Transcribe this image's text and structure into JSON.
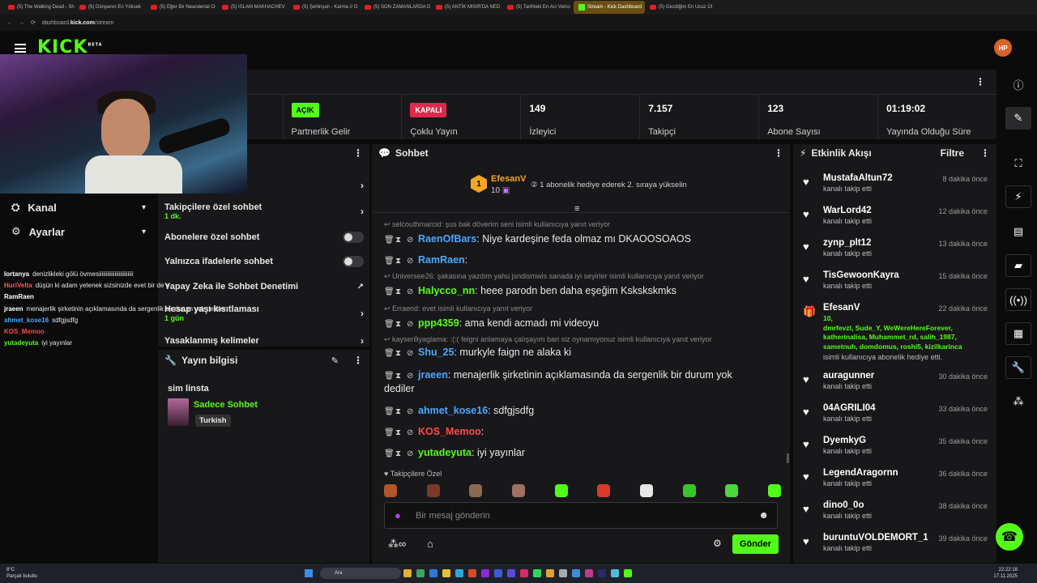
{
  "browser": {
    "tabs": [
      "(5) The Walking Dead - Sh",
      "(5) Dünyanın En Yüksek",
      "(5) Eğer Bir Neandertal O",
      "(5) ISLAM MAKHACHEV",
      "(5) Şehinşah - Karma // O",
      "(5) SON ZAMANLARDA D",
      "(5) ANTİK MISIR'DA NED",
      "(5) Tarihteki En Acı Verici",
      "Stream - Kick Dashboard",
      "(5) Gezdiğim En Ucuz Ül"
    ],
    "url_host": "dashboard.",
    "url_bold": "kick.com",
    "url_path": "/stream"
  },
  "kick": {
    "logo": "KICK",
    "beta": "BETA",
    "avatar": "HP"
  },
  "leftnav": {
    "kanal": "Kanal",
    "ayarlar": "Ayarlar"
  },
  "overlay_chat": [
    {
      "user": "lortanya",
      "color": "#ffffff",
      "msg": "denizlikleki gölü övmesiiiiiiiiiiiiiiiiiiiiiiii"
    },
    {
      "user": "HuriVelta",
      "color": "#ff5b5b",
      "msg": "düşün ki adam yetenek sizsinizde evet bir de o"
    },
    {
      "user": "RamRaen",
      "color": "#ffffff",
      "msg": ""
    },
    {
      "user": "jraeen",
      "color": "#ffffff",
      "msg": "menajerlik şirketinin açıklamasında da sergenlik bir durum yok dediler"
    },
    {
      "user": "ahmet_kose16",
      "color": "#4aa8ff",
      "msg": "sdfgjsdfg"
    },
    {
      "user": "KOS_Memoo",
      "color": "#ff4a4a",
      "msg": ""
    },
    {
      "user": "yutadeyuta",
      "color": "#53fc18",
      "msg": "iyi yayınlar"
    }
  ],
  "stats": {
    "partnerlik": {
      "badge": "AÇIK",
      "label": "Partnerlik Gelir"
    },
    "coklu": {
      "badge": "KAPALI",
      "label": "Çoklu Yayın"
    },
    "izleyici": {
      "value": "149",
      "label": "İzleyici"
    },
    "takipci": {
      "value": "7.157",
      "label": "Takipçi"
    },
    "abone": {
      "value": "123",
      "label": "Abone Sayısı"
    },
    "sure": {
      "value": "01:19:02",
      "label": "Yayında Olduğu Süre"
    }
  },
  "settings": {
    "takipci_only": "Takipçilere özel sohbet",
    "takipci_sub": "1 dk.",
    "abone_only": "Abonelere özel sohbet",
    "ifade_only": "Yalnızca ifadelerle sohbet",
    "ai": "Yapay Zeka ile Sohbet Denetimi",
    "hesap": "Hesap yaşı kısıtlaması",
    "hesap_sub": "1 gün",
    "yasak": "Yasaklanmış kelimeler"
  },
  "yayin": {
    "title": "Yayın bilgisi",
    "stream_title": "sim linsta",
    "category": "Sadece Sohbet",
    "tag": "Turkish"
  },
  "chat": {
    "title": "Sohbet",
    "pinned_user": "EfesanV",
    "pinned_count": "10",
    "pinned_note": "1 abonelik hediye ederek 2. sıraya yükselin",
    "messages": [
      {
        "reply": "selcouthmarcid: şus bak döverim seni isimli kullanıcıya yanıt veriyor"
      },
      {
        "user": "RaenOfBars",
        "color": "#4aa8ff",
        "text": "Niye kardeşine feda olmaz mı DKAOOSOAOS"
      },
      {
        "user": "RamRaen",
        "color": "#4aa8ff",
        "text": ""
      },
      {
        "reply": "Universee26: şakasına yazdım yahu jsndismwis sanada iyi seyirler isimli kullanıcıya yanıt veriyor"
      },
      {
        "user": "Halycco_nn",
        "color": "#53fc18",
        "text": "heee parodn ben daha eşeğim Kskskskmks"
      },
      {
        "reply": "Erraend: evet isimli kullanıcıya yanıt veriyor"
      },
      {
        "user": "ppp4359",
        "color": "#53fc18",
        "text": "ama kendi acmadı mi videoyu"
      },
      {
        "reply": "kayseriliyaglama: :(:( feigni anlamaya çalışayım bari siz oynamıyonuz isimli kullanıcıya yanıt veriyor"
      },
      {
        "user": "Shu_25",
        "color": "#4aa8ff",
        "text": "murkyle faign ne alaka ki"
      },
      {
        "user": "jraeen",
        "color": "#4aa8ff",
        "text": "menajerlik şirketinin açıklamasında da sergenlik bir durum yok"
      },
      {
        "text2": "dediler"
      },
      {
        "user": "ahmet_kose16",
        "color": "#4aa8ff",
        "text": "sdfgjsdfg"
      },
      {
        "user": "KOS_Memoo",
        "color": "#ff4a4a",
        "text": ""
      },
      {
        "user": "yutadeyuta",
        "color": "#53fc18",
        "text": "iyi yayınlar"
      }
    ],
    "followers_only": "Takipçilere Özel",
    "placeholder": "Bir mesaj gönderin",
    "send": "Gönder"
  },
  "feed": {
    "title": "Etkinlik Akışı",
    "filter": "Filtre",
    "items": [
      {
        "user": "MustafaAltun72",
        "time": "8 dakika önce",
        "action": "kanalı takip etti"
      },
      {
        "user": "WarLord42",
        "time": "12 dakika önce",
        "action": "kanalı takip etti"
      },
      {
        "user": "zynp_plt12",
        "time": "13 dakika önce",
        "action": "kanalı takip etti"
      },
      {
        "user": "TisGewoonKayra",
        "time": "15 dakika önce",
        "action": "kanalı takip etti"
      },
      {
        "user": "EfesanV",
        "time": "22 dakika önce",
        "gift_count": "10,",
        "gift_names": "dmrfevzl, Sude_Y, WeWereHereForever, katherinalisa, Muhammet_rd, salih_1987, sametnuh, domdomus, roshi5, kizilkarinca",
        "action": "isimli kullanıcıya abonelik hediye etti."
      },
      {
        "user": "auragunner",
        "time": "30 dakika önce",
        "action": "kanalı takip etti"
      },
      {
        "user": "04AGRILI04",
        "time": "33 dakika önce",
        "action": "kanalı takip etti"
      },
      {
        "user": "DyemkyG",
        "time": "35 dakika önce",
        "action": "kanalı takip etti"
      },
      {
        "user": "LegendAragornn",
        "time": "36 dakika önce",
        "action": "kanalı takip etti"
      },
      {
        "user": "dino0_0o",
        "time": "38 dakika önce",
        "action": "kanalı takip etti"
      },
      {
        "user": "buruntuVOLDEMORT_1",
        "time": "39 dakika önce",
        "action": "kanalı takip etti"
      }
    ]
  },
  "taskbar": {
    "weather": "8°C",
    "weather_sub": "Parçalı bulutlu",
    "search": "Ara",
    "time": "22:22:18",
    "date": "17.11.2025"
  }
}
